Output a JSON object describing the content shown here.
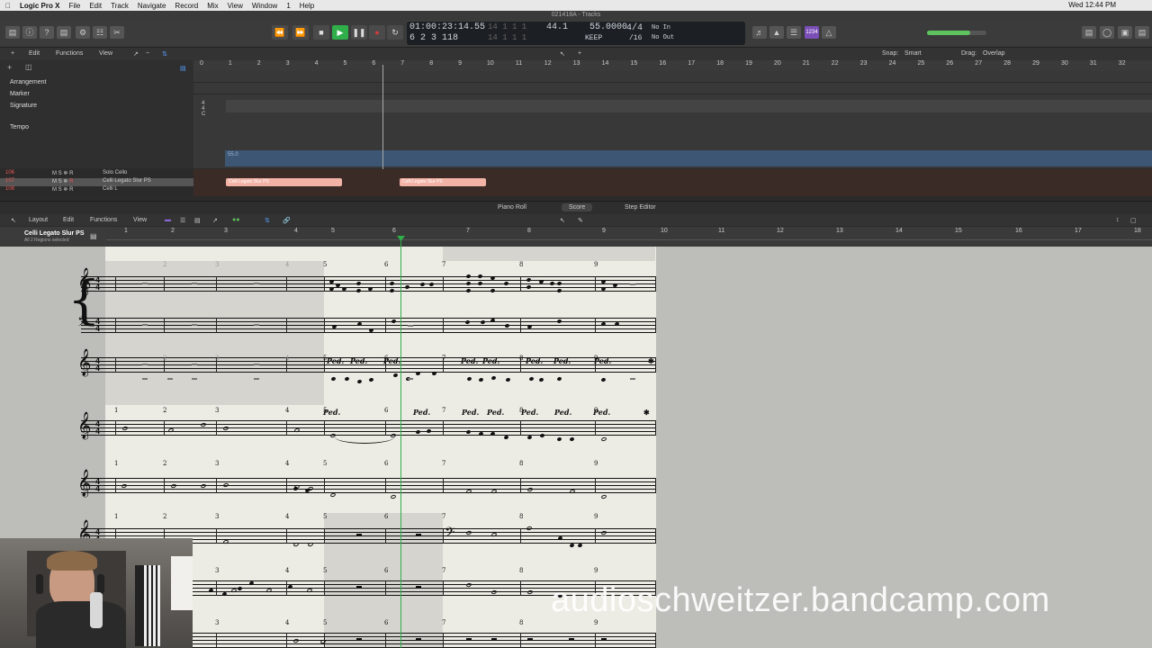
{
  "menubar": {
    "app": "Logic Pro X",
    "items": [
      "File",
      "Edit",
      "Track",
      "Navigate",
      "Record",
      "Mix",
      "View",
      "Window",
      "1",
      "Help"
    ],
    "clock": "Wed 12:44 PM"
  },
  "window_title": "021418A - Tracks",
  "lcd": {
    "position": "01:00:23:14.55",
    "bars": "6 2 3 118",
    "dim_top": "14 1 1 1",
    "dim_bottom": "14 1 1 1",
    "tempo_a": "44.1",
    "tempo_b": "55.0000",
    "keep": "KEEP",
    "signature": "4/4",
    "division": "/16",
    "no_in": "No In",
    "no_out": "No Out",
    "badge": "①"
  },
  "tracks_bar": {
    "edit": "Edit",
    "functions": "Functions",
    "view": "View",
    "snap_label": "Snap:",
    "snap_value": "Smart",
    "drag_label": "Drag:",
    "drag_value": "Overlap"
  },
  "ruler_bars": [
    "0",
    "1",
    "2",
    "3",
    "4",
    "5",
    "6",
    "7",
    "8",
    "9",
    "10",
    "11",
    "12",
    "13",
    "14",
    "15",
    "16",
    "17",
    "18",
    "19",
    "20",
    "21",
    "22",
    "23",
    "24",
    "25",
    "26",
    "27",
    "28",
    "29",
    "30",
    "31",
    "32"
  ],
  "global_tracks": [
    "Arrangement",
    "Marker",
    "Signature",
    "Tempo"
  ],
  "tempo_value": "55.0",
  "signature_marker": "4\n4\nC",
  "tracks": [
    {
      "num": "106",
      "name": "Solo Cello",
      "m": "M",
      "s": "S",
      "r": "R"
    },
    {
      "num": "107",
      "name": "Celli Legato Slur PS",
      "m": "M",
      "s": "S",
      "r": "R"
    },
    {
      "num": "108",
      "name": "Celli L",
      "m": "M",
      "s": "S",
      "r": "R"
    }
  ],
  "regions": [
    "Celli Legato Slur PS",
    "Celli Legato Slur PS"
  ],
  "editor_tabs": [
    "Piano Roll",
    "Score",
    "Step Editor"
  ],
  "score_bar": {
    "layout": "Layout",
    "edit": "Edit",
    "functions": "Functions",
    "view": "View"
  },
  "score_region": {
    "name": "Celli Legato Slur PS",
    "sub": "All 2 Regions selected"
  },
  "score_ruler": [
    "1",
    "2",
    "3",
    "4",
    "5",
    "6",
    "7",
    "8",
    "9",
    "10",
    "11",
    "12",
    "13",
    "14",
    "15",
    "16",
    "17",
    "18"
  ],
  "measure_numbers": [
    "1",
    "2",
    "3",
    "4",
    "5",
    "6",
    "7",
    "8",
    "9"
  ],
  "pedal": "Ped.",
  "time_signature": {
    "num": "4",
    "den": "4"
  },
  "watermark": "audioschweitzer.bandcamp.com",
  "colors": {
    "playhead": "#2fae4a",
    "region": "#f2b3a6",
    "tempo_band": "#3c5673",
    "record": "#d23c3c",
    "play": "#2fae4a"
  }
}
